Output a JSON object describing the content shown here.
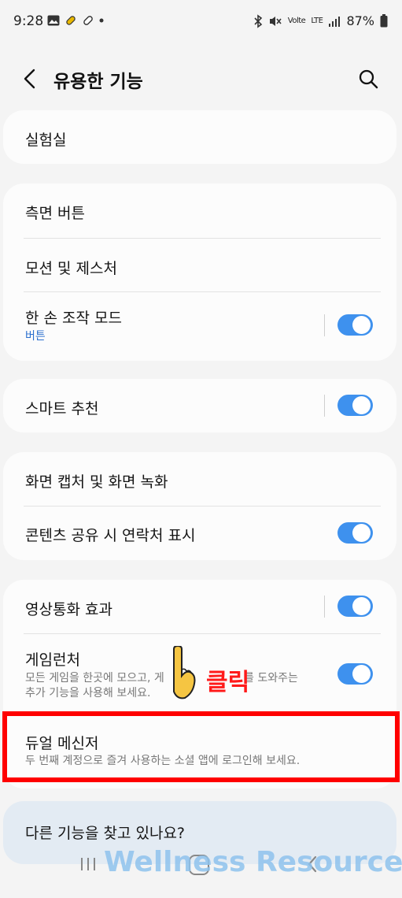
{
  "status_bar": {
    "time": "9:28",
    "volte_label": "Volte",
    "network": "LTE",
    "battery": "87%"
  },
  "header": {
    "title": "유용한 기능"
  },
  "items": {
    "lab": {
      "label": "실험실"
    },
    "side_button": {
      "label": "측면 버튼"
    },
    "motions": {
      "label": "모션 및 제스처"
    },
    "one_hand": {
      "label": "한 손 조작 모드",
      "sub": "버튼",
      "toggle_on": true
    },
    "smart_suggest": {
      "label": "스마트 추천",
      "toggle_on": true
    },
    "screenshot": {
      "label": "화면 캡처 및 화면 녹화"
    },
    "share_contacts": {
      "label": "콘텐츠 공유 시 연락처 표시",
      "toggle_on": true
    },
    "video_call": {
      "label": "영상통화 효과",
      "toggle_on": true
    },
    "game_launcher": {
      "label": "게임런처",
      "sub1": "모든 게임을 한곳에 모으고, 게",
      "sub1b": "를 도와주는",
      "sub2": "추가 기능을 사용해 보세요.",
      "toggle_on": true
    },
    "dual_messenger": {
      "label": "듀얼 메신저",
      "sub": "두 번째 계정으로 즐겨 사용하는 소셜 앱에 로그인해 보세요."
    }
  },
  "footer": {
    "looking_label": "다른 기능을 찾고 있나요?"
  },
  "annotation": {
    "click_label": "클릭"
  },
  "watermark": "Wellness Resources",
  "colors": {
    "accent": "#3e91ee",
    "highlight": "#ff0000",
    "sub_blue": "#2b6fce"
  }
}
